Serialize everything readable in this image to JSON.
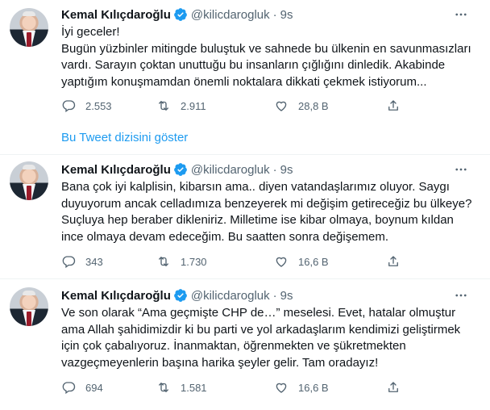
{
  "tweets": [
    {
      "author": "Kemal Kılıçdaroğlu",
      "handle": "@kilicdarogluk",
      "separator": "·",
      "time": "9s",
      "lines": [
        "İyi geceler!",
        "Bugün yüzbinler mitingde buluştuk ve sahnede bu ülkenin en savunmasızları",
        "vardı. Sarayın çoktan unuttuğu bu insanların çığlığını dinledik. Akabinde",
        "yaptığım konuşmamdan önemli noktalara dikkati çekmek istiyorum..."
      ],
      "replies": "2.553",
      "retweets": "2.911",
      "likes": "28,8 B"
    },
    {
      "author": "Kemal Kılıçdaroğlu",
      "handle": "@kilicdarogluk",
      "separator": "·",
      "time": "9s",
      "lines": [
        "Bana çok iyi kalplisin, kibarsın ama.. diyen vatandaşlarımız oluyor. Saygı",
        "duyuyorum ancak celladımıza benzeyerek mi değişim getireceğiz bu ülkeye?",
        "Suçluya hep beraber dikleniriz. Milletime ise kibar olmaya, boynum kıldan",
        "ince olmaya devam edeceğim. Bu saatten sonra değişemem."
      ],
      "replies": "343",
      "retweets": "1.730",
      "likes": "16,6 B"
    },
    {
      "author": "Kemal Kılıçdaroğlu",
      "handle": "@kilicdarogluk",
      "separator": "·",
      "time": "9s",
      "lines": [
        "Ve son olarak “Ama geçmişte CHP de…” meselesi. Evet, hatalar olmuştur",
        "ama Allah şahidimizdir ki bu parti ve yol arkadaşlarım kendimizi geliştirmek",
        "için çok çabalıyoruz. İnanmaktan, öğrenmekten ve şükretmekten",
        "vazgeçmeyenlerin başına harika şeyler gelir. Tam oradayız!"
      ],
      "replies": "694",
      "retweets": "1.581",
      "likes": "16,6 B"
    }
  ],
  "thread_link": "Bu Tweet dizisini göster",
  "colors": {
    "accent": "#1d9bf0",
    "muted": "#536471",
    "text": "#0f1419",
    "divider": "#eff3f4"
  },
  "icons": {
    "verified": "verified-badge-icon",
    "more": "more-horizontal-icon",
    "reply": "reply-bubble-icon",
    "retweet": "retweet-icon",
    "like": "heart-icon",
    "share": "share-icon"
  }
}
